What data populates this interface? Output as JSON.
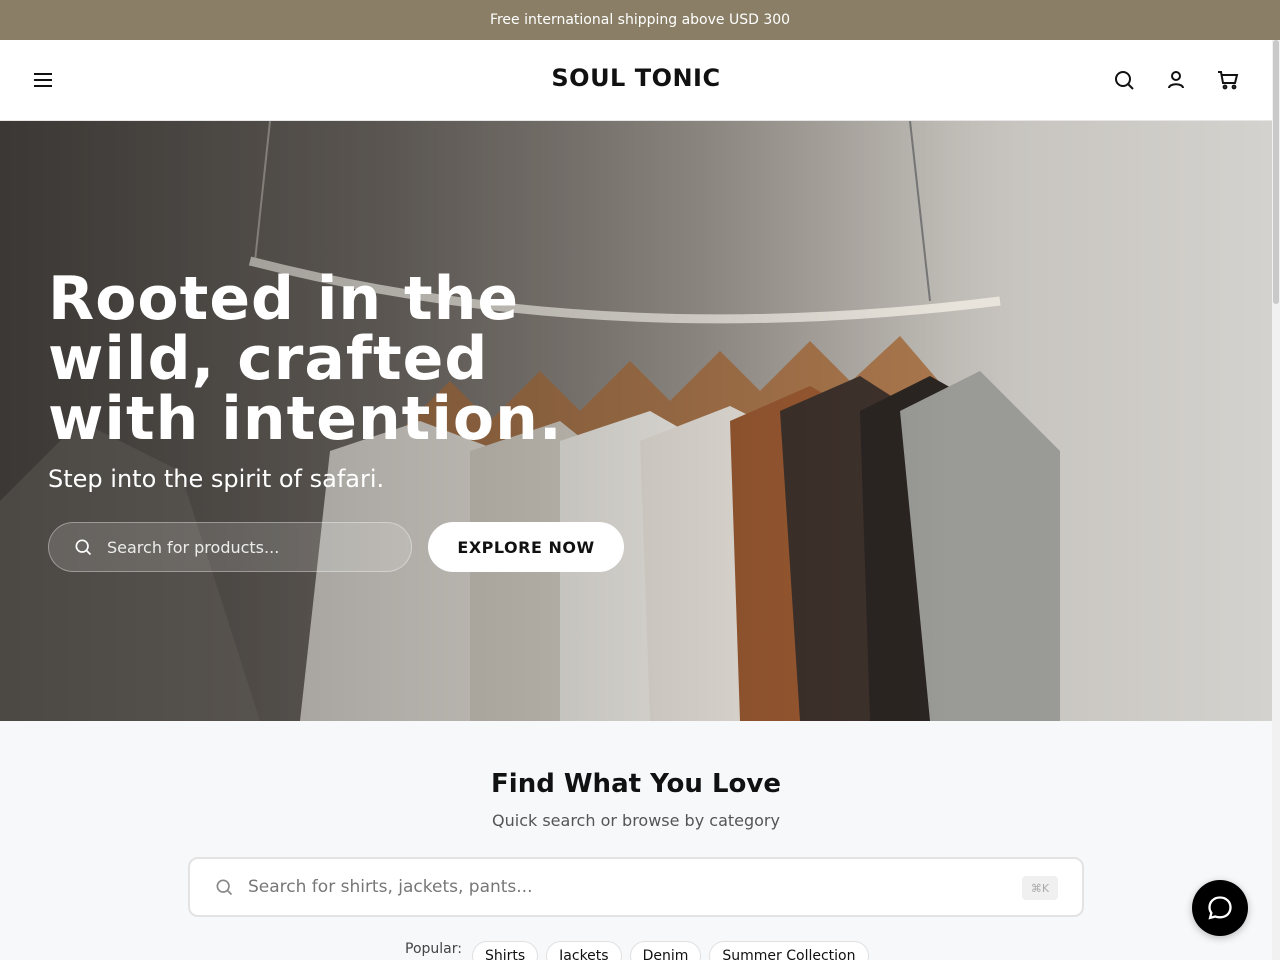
{
  "announcement": {
    "text": "Free international shipping above USD 300"
  },
  "header": {
    "brand": "SOUL TONIC",
    "icons": [
      "menu-icon",
      "search-icon",
      "account-icon",
      "cart-icon"
    ]
  },
  "hero": {
    "title": "Rooted in the wild, crafted with intention.",
    "subtitle": "Step into the spirit of safari.",
    "search_placeholder": "Search for products...",
    "cta_label": "EXPLORE NOW"
  },
  "find": {
    "title": "Find What You Love",
    "subtitle": "Quick search or browse by category",
    "search_placeholder": "Search for shirts, jackets, pants...",
    "shortcut": "⌘K",
    "popular_label": "Popular:",
    "popular_tags": [
      "Shirts",
      "Jackets",
      "Denim",
      "Summer Collection"
    ]
  },
  "colors": {
    "announcement_bg": "#8a7f66",
    "brand_text": "#111111",
    "cta_bg": "#ffffff",
    "chat_bg": "#000000"
  },
  "chat": {
    "icon": "chat-bubble-icon"
  }
}
